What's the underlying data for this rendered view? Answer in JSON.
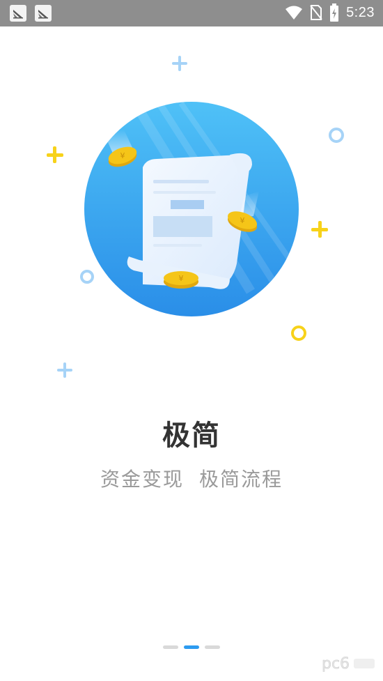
{
  "status_bar": {
    "time": "5:23",
    "left_icons": [
      "app-notification-icon",
      "app-notification-icon"
    ],
    "right_icons": [
      "wifi-icon",
      "no-sim-icon",
      "battery-charging-icon"
    ]
  },
  "onboarding": {
    "title": "极简",
    "subtitle_part1": "资金变现",
    "subtitle_part2": "极简流程",
    "coin_symbol": "¥",
    "page_count": 3,
    "active_page_index": 1
  },
  "watermark": {
    "text": "pc6"
  },
  "colors": {
    "status_bar_bg": "#8e8e8e",
    "circle_gradient_top": "#4fc1f7",
    "circle_gradient_bottom": "#2a8ee8",
    "coin": "#f5c518",
    "deco_yellow": "#f7d21a",
    "deco_blue": "#a6d3f7",
    "indicator_active": "#2d9bf0",
    "indicator_inactive": "#d9d9d9",
    "title": "#333333",
    "subtitle": "#9a9a9a"
  }
}
